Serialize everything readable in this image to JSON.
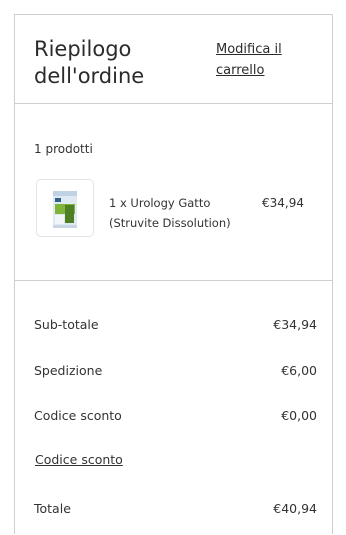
{
  "header": {
    "title": "Riepilogo dell'ordine",
    "edit_cart_link": "Modifica il carrello"
  },
  "products": {
    "count_label": "1 prodotti",
    "items": [
      {
        "name": "1 x Urology Gatto (Struvite Dissolution)",
        "price": "€34,94",
        "thumbnail_icon": "product-bag-icon"
      }
    ]
  },
  "totals": {
    "subtotal_label": "Sub-totale",
    "subtotal_value": "€34,94",
    "shipping_label": "Spedizione",
    "shipping_value": "€6,00",
    "discount_label": "Codice sconto",
    "discount_value": "€0,00",
    "discount_link": "Codice sconto",
    "total_label": "Totale",
    "total_value": "€40,94"
  },
  "colors": {
    "border": "#cfcfcf",
    "text": "#333333"
  }
}
